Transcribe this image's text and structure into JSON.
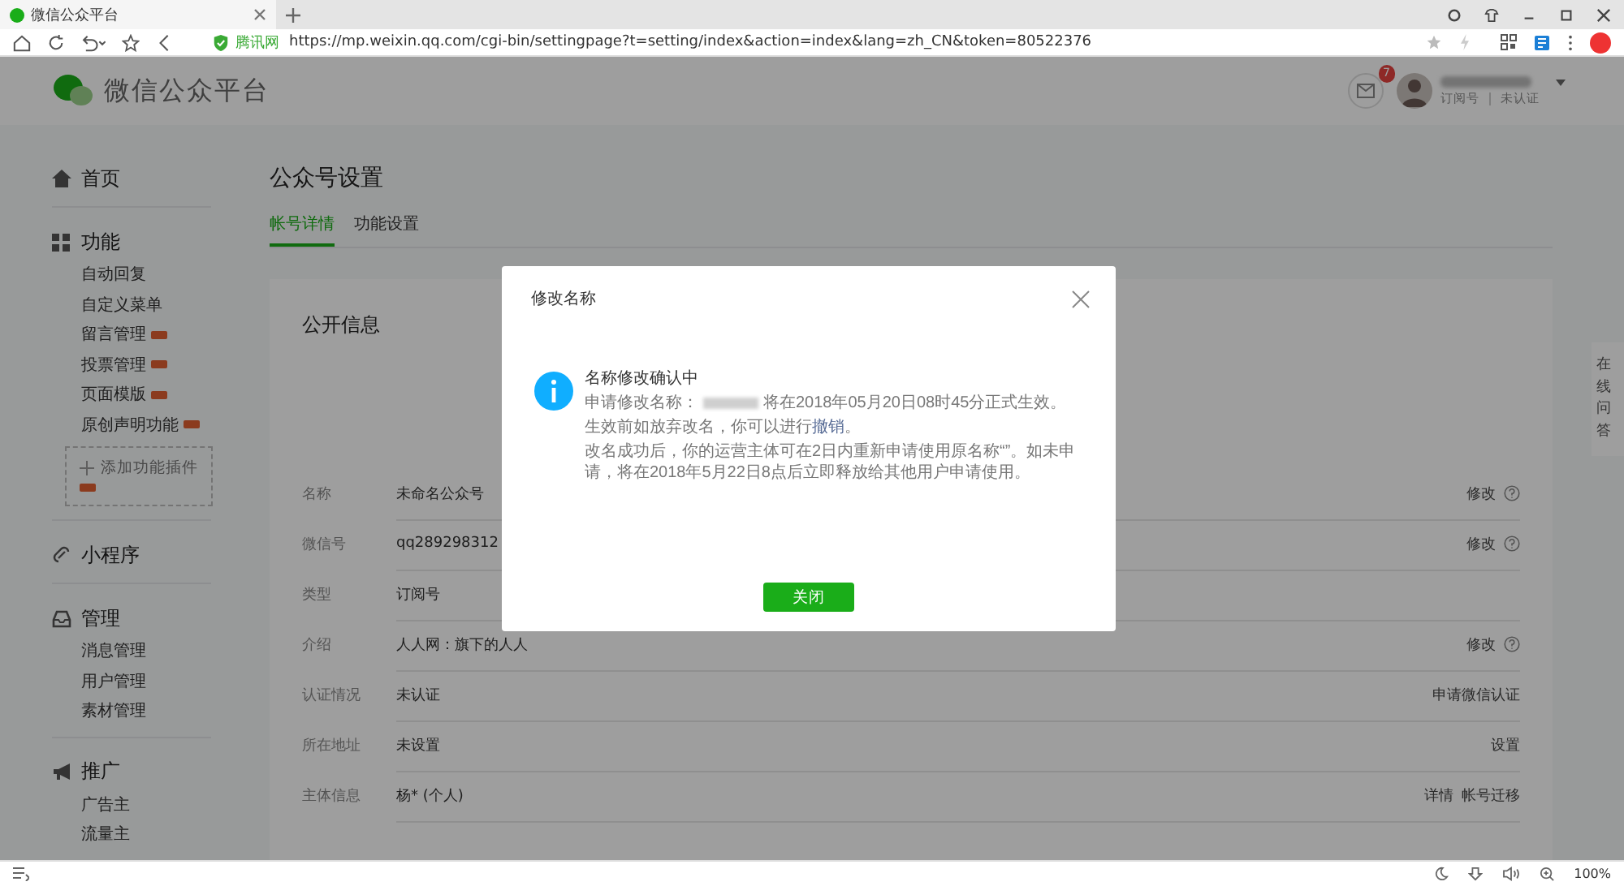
{
  "browser": {
    "tab_title": "微信公众平台",
    "security_label": "腾讯网",
    "url": "https://mp.weixin.qq.com/cgi-bin/settingpage?t=setting/index&action=index&lang=zh_CN&token=80522376",
    "zoom": "100%"
  },
  "header": {
    "logo_text": "微信公众平台",
    "mail_count": "7",
    "account_type": "订阅号",
    "verify_status": "未认证"
  },
  "sidebar": [
    {
      "label": "首页"
    },
    {
      "label": "功能",
      "items": [
        {
          "label": "自动回复",
          "new": false
        },
        {
          "label": "自定义菜单",
          "new": false
        },
        {
          "label": "留言管理",
          "new": true
        },
        {
          "label": "投票管理",
          "new": true
        },
        {
          "label": "页面模版",
          "new": true
        },
        {
          "label": "原创声明功能",
          "new": true
        }
      ],
      "add_plugin": "添加功能插件"
    },
    {
      "label": "小程序"
    },
    {
      "label": "管理",
      "items": [
        {
          "label": "消息管理",
          "new": false
        },
        {
          "label": "用户管理",
          "new": false
        },
        {
          "label": "素材管理",
          "new": false
        }
      ]
    },
    {
      "label": "推广",
      "items": [
        {
          "label": "广告主",
          "new": false
        },
        {
          "label": "流量主",
          "new": false
        }
      ]
    }
  ],
  "page_title": "公众号设置",
  "tabs": [
    {
      "label": "帐号详情",
      "selected": true
    },
    {
      "label": "功能设置",
      "selected": false
    }
  ],
  "section_title": "公开信息",
  "rows": [
    {
      "label": "名称",
      "value": "未命名公众号",
      "actions": [
        "修改"
      ],
      "help": true
    },
    {
      "label": "微信号",
      "value": "qq289298312",
      "actions": [
        "修改"
      ],
      "help": true
    },
    {
      "label": "类型",
      "value": "订阅号",
      "actions": [],
      "help": false
    },
    {
      "label": "介绍",
      "value": "人人网：旗下的人人",
      "actions": [
        "修改"
      ],
      "help": true
    },
    {
      "label": "认证情况",
      "value": "未认证",
      "actions": [
        "申请微信认证"
      ],
      "help": false
    },
    {
      "label": "所在地址",
      "value": "未设置",
      "actions": [
        "设置"
      ],
      "help": false
    },
    {
      "label": "主体信息",
      "value": "杨* (个人)",
      "actions": [
        "详情",
        "帐号迁移"
      ],
      "help": false
    }
  ],
  "side_help": "在线问答",
  "dialog": {
    "title": "修改名称",
    "heading": "名称修改确认中",
    "apply_prefix": "申请修改名称：",
    "apply_suffix": "将在2018年05月20日08时45分正式生效。",
    "cancel_prefix": "生效前如放弃改名，你可以进行",
    "cancel_link": "撤销",
    "cancel_suffix": "。",
    "note": "改名成功后，你的运营主体可在2日内重新申请使用原名称“”。如未申请，将在2018年5月22日8点后立即释放给其他用户申请使用。",
    "button": "关闭"
  }
}
